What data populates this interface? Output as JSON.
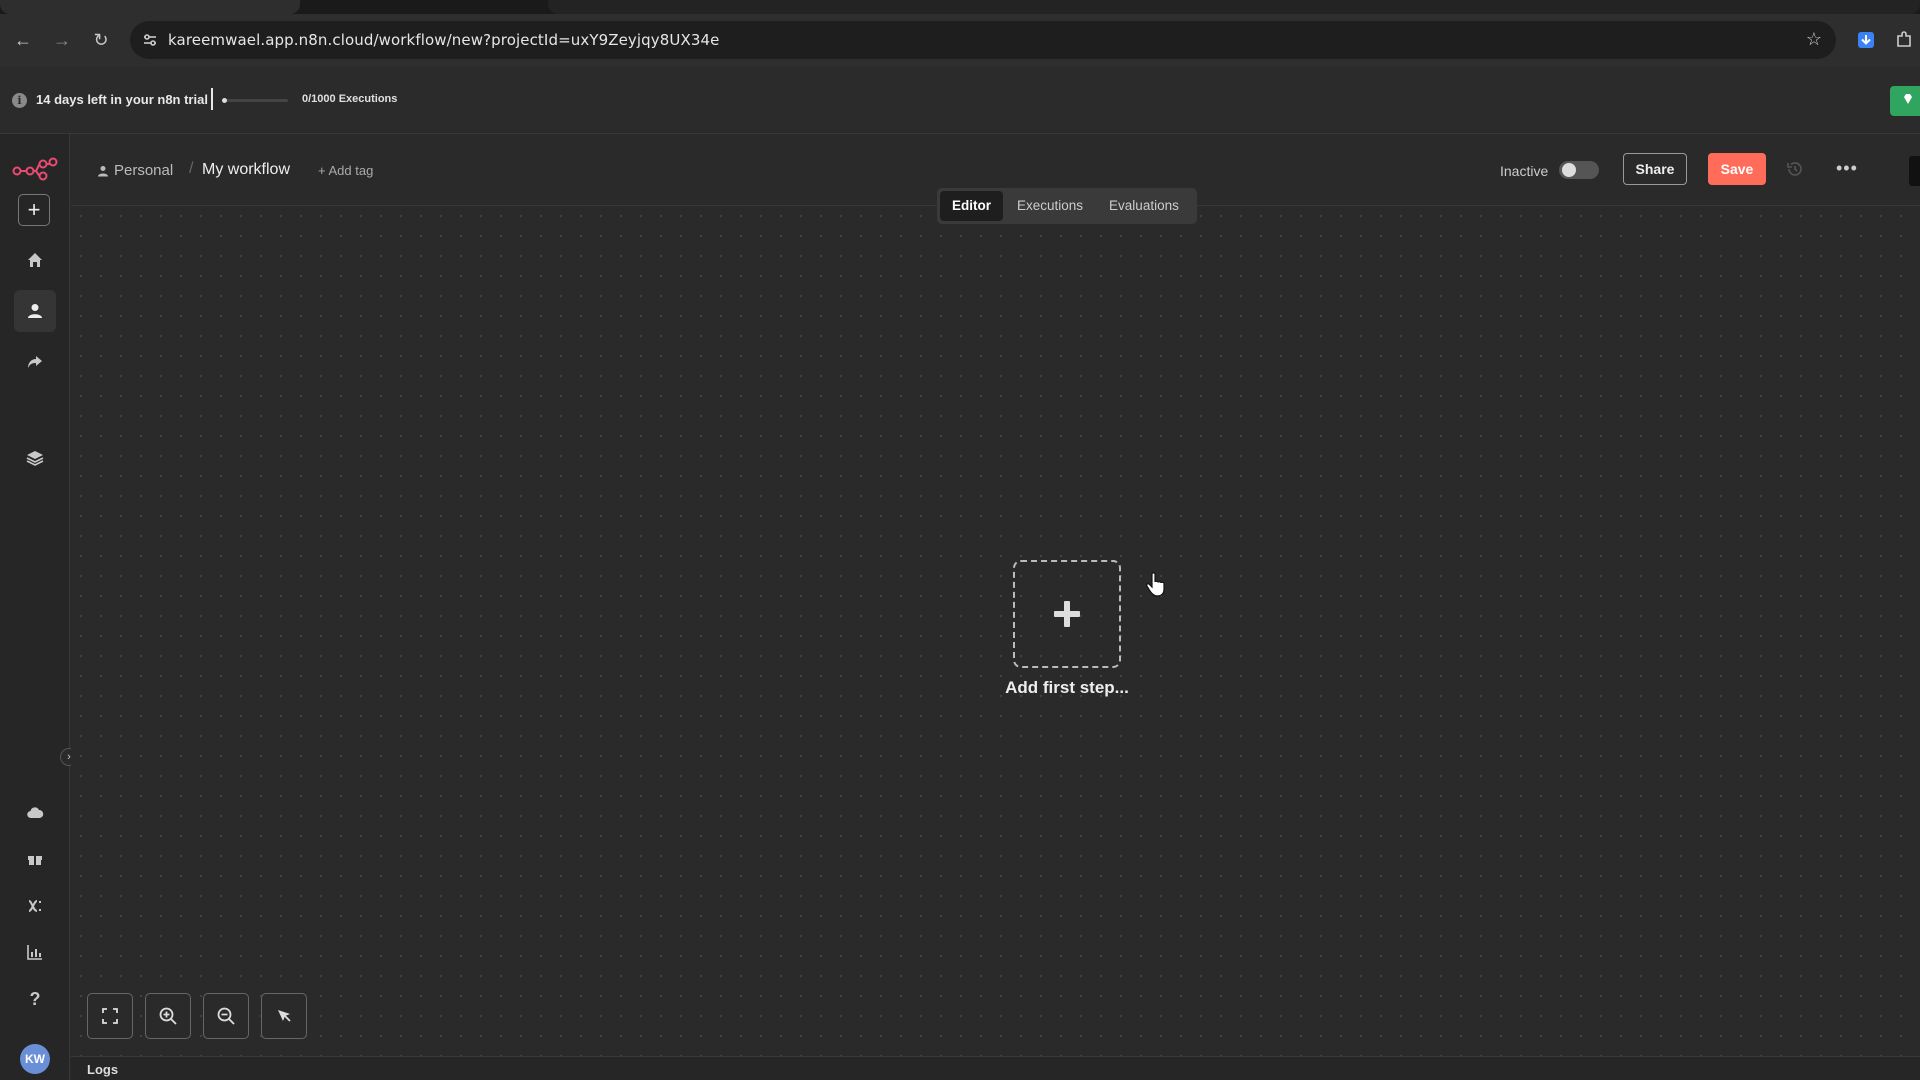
{
  "browser": {
    "url": "kareemwael.app.n8n.cloud/workflow/new?projectId=uxY9Zeyjqy8UX34e",
    "icons": [
      "back-icon",
      "forward-icon",
      "reload-icon",
      "site-info-icon",
      "bookmark-star-icon",
      "download-icon",
      "extensions-icon"
    ]
  },
  "banner": {
    "trial_text": "14 days left in your n8n trial",
    "executions_text": "0/1000 Executions",
    "executions_used_fraction": 0.0
  },
  "sidebar": {
    "items": [
      {
        "name": "home",
        "icon": "home-icon"
      },
      {
        "name": "personal",
        "icon": "user-icon",
        "active": true
      },
      {
        "name": "shared",
        "icon": "share-arrow-icon"
      },
      {
        "name": "templates",
        "icon": "layers-icon"
      },
      {
        "name": "cloud",
        "icon": "cloud-icon"
      },
      {
        "name": "community",
        "icon": "gift-icon"
      },
      {
        "name": "variables",
        "icon": "variable-icon"
      },
      {
        "name": "insights",
        "icon": "bar-chart-icon"
      },
      {
        "name": "help",
        "icon": "question-icon"
      }
    ],
    "avatar_initials": "KW"
  },
  "header": {
    "project": "Personal",
    "separator": "/",
    "workflow_name": "My workflow",
    "add_tag": "+ Add tag",
    "status_label": "Inactive",
    "share_label": "Share",
    "save_label": "Save",
    "more_label": "•••"
  },
  "tabs": [
    {
      "label": "Editor",
      "active": true
    },
    {
      "label": "Executions",
      "active": false
    },
    {
      "label": "Evaluations",
      "active": false
    }
  ],
  "canvas": {
    "add_first_step_label": "Add first step..."
  },
  "logs": {
    "label": "Logs"
  },
  "colors": {
    "accent": "#ff6d5a",
    "upgrade": "#2fa55f",
    "background": "#2a2a2a"
  }
}
